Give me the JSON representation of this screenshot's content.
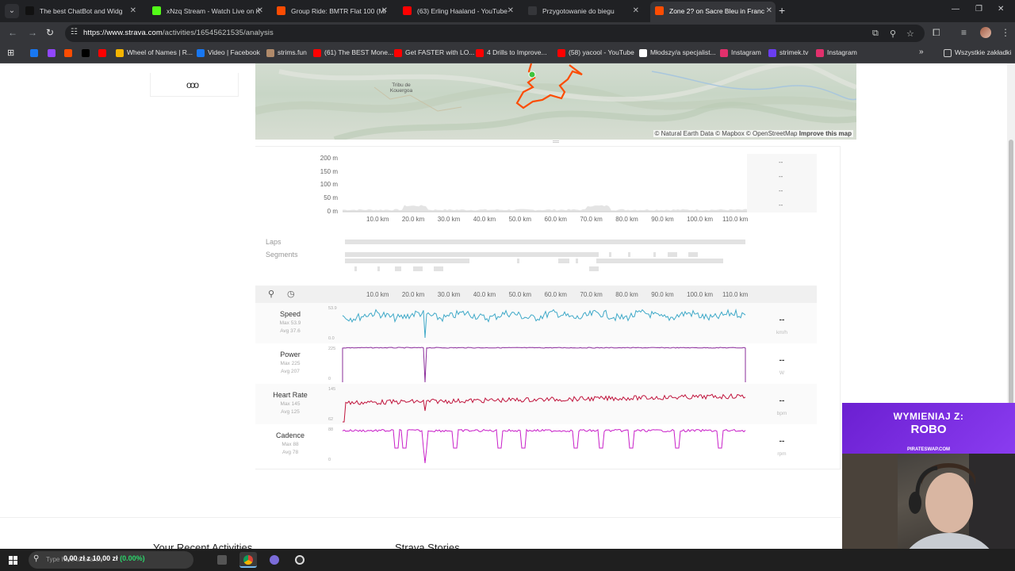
{
  "browser": {
    "tabs": [
      {
        "title": "The best ChatBot and Widg",
        "color": "#111111",
        "active": false
      },
      {
        "title": "xNzq Stream - Watch Live on K",
        "color": "#53fc18",
        "active": false
      },
      {
        "title": "Group Ride: BMTR Flat 100 (Mi",
        "color": "#fc4c02",
        "active": false
      },
      {
        "title": "(63) Erling Haaland - YouTube",
        "color": "#ff0000",
        "active": false
      },
      {
        "title": "Przygotowanie do biegu",
        "color": "#35363a",
        "active": false
      },
      {
        "title": "Zone 2? on Sacre Bleu in Franc",
        "color": "#fc4c02",
        "active": true
      }
    ],
    "url_host": "https://www.strava.com",
    "url_path": "/activities/16545621535/analysis",
    "bookmarks": [
      {
        "label": "",
        "color": "#1877f2"
      },
      {
        "label": "",
        "color": "#9146ff"
      },
      {
        "label": "",
        "color": "#fc4c02"
      },
      {
        "label": "",
        "color": "#000000"
      },
      {
        "label": "",
        "color": "#ff0000"
      },
      {
        "label": "Wheel of Names | R...",
        "color": "#f4b400"
      },
      {
        "label": "Video | Facebook",
        "color": "#1877f2"
      },
      {
        "label": "strims.fun",
        "color": "#b08a6a"
      },
      {
        "label": "(61) The BEST Mone...",
        "color": "#ff0000"
      },
      {
        "label": "Get FASTER with LO...",
        "color": "#ff0000"
      },
      {
        "label": "4 Drills to Improve...",
        "color": "#ff0000"
      },
      {
        "label": "(58) yacool - YouTube",
        "color": "#ff0000"
      },
      {
        "label": "Młodszy/a specjalist...",
        "color": "#ffffff"
      },
      {
        "label": "Instagram",
        "color": "#e1306c"
      },
      {
        "label": "strimek.tv",
        "color": "#6a3df0"
      },
      {
        "label": "Instagram",
        "color": "#e1306c"
      }
    ],
    "all_bookmarks": "Wszystkie zakładki"
  },
  "map": {
    "place_label": "Tribu de Kouergoa",
    "attribution": "© Natural Earth Data © Mapbox © OpenStreetMap",
    "improve_link": "Improve this map",
    "route_color": "#fc4c02"
  },
  "elevation": {
    "y_ticks": [
      "200 m",
      "150 m",
      "100 m",
      "50 m",
      "0 m"
    ],
    "x_ticks": [
      "10.0 km",
      "20.0 km",
      "30.0 km",
      "40.0 km",
      "50.0 km",
      "60.0 km",
      "70.0 km",
      "80.0 km",
      "90.0 km",
      "100.0 km",
      "110.0 km"
    ],
    "side_values": [
      "--",
      "--",
      "--",
      "--"
    ],
    "laps_label": "Laps",
    "segments_label": "Segments"
  },
  "analysis": {
    "x_ticks": [
      "10.0 km",
      "20.0 km",
      "30.0 km",
      "40.0 km",
      "50.0 km",
      "60.0 km",
      "70.0 km",
      "80.0 km",
      "90.0 km",
      "100.0 km",
      "110.0 km"
    ],
    "metrics": [
      {
        "name": "Speed",
        "max": "Max 53.9",
        "avg": "Avg 37.6",
        "top": "53.9",
        "bottom": "0.0",
        "value": "--",
        "unit": "km/h",
        "color": "#3fa9c8"
      },
      {
        "name": "Power",
        "max": "Max 225",
        "avg": "Avg 207",
        "top": "225",
        "bottom": "0",
        "value": "--",
        "unit": "W",
        "color": "#8a2c9a"
      },
      {
        "name": "Heart Rate",
        "max": "Max 145",
        "avg": "Avg 125",
        "top": "145",
        "bottom": "62",
        "value": "--",
        "unit": "bpm",
        "color": "#c0143c"
      },
      {
        "name": "Cadence",
        "max": "Max 88",
        "avg": "Avg 78",
        "top": "88",
        "bottom": "0",
        "value": "--",
        "unit": "rpm",
        "color": "#c81ec8"
      }
    ]
  },
  "bottom": {
    "recent": "Your Recent Activities",
    "stories": "Strava Stories"
  },
  "overlay": {
    "line1": "WYMIENIAJ Z:",
    "line2": "ROBO",
    "line3": "PIRATESWAP.COM"
  },
  "taskbar": {
    "search_placeholder": "Type here to search",
    "ticker_value": "0,00 zł",
    "ticker_sep": "z",
    "ticker_total": "10,00 zł",
    "ticker_change": "(0.00%)"
  }
}
